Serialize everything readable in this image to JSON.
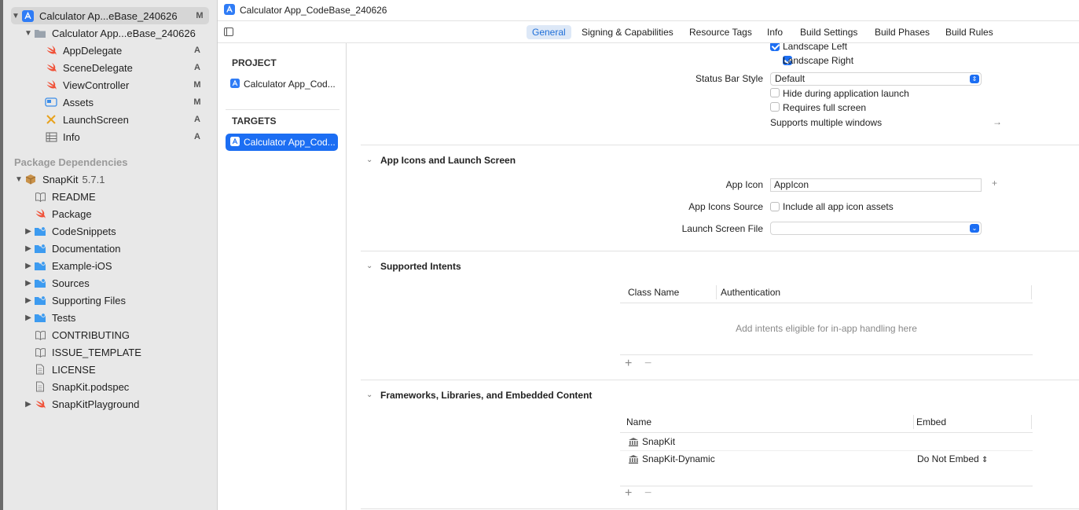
{
  "window": {
    "title": "Calculator App_CodeBase_240626"
  },
  "navigator": {
    "project_root": {
      "label": "Calculator Ap...eBase_240626",
      "badge": "M"
    },
    "group": {
      "label": "Calculator App...eBase_240626"
    },
    "files": [
      {
        "label": "AppDelegate",
        "badge": "A",
        "icon": "swift-icon"
      },
      {
        "label": "SceneDelegate",
        "badge": "A",
        "icon": "swift-icon"
      },
      {
        "label": "ViewController",
        "badge": "M",
        "icon": "swift-icon"
      },
      {
        "label": "Assets",
        "badge": "M",
        "icon": "asset-catalog-icon"
      },
      {
        "label": "LaunchScreen",
        "badge": "A",
        "icon": "storyboard-icon"
      },
      {
        "label": "Info",
        "badge": "A",
        "icon": "plist-icon"
      }
    ],
    "package_deps_title": "Package Dependencies",
    "snapkit": {
      "label": "SnapKit",
      "version": "5.7.1"
    },
    "snapkit_items": [
      {
        "label": "README",
        "icon": "book-icon",
        "folder": false
      },
      {
        "label": "Package",
        "icon": "swift-icon",
        "folder": false
      },
      {
        "label": "CodeSnippets",
        "icon": "folder-icon",
        "folder": true
      },
      {
        "label": "Documentation",
        "icon": "folder-icon",
        "folder": true
      },
      {
        "label": "Example-iOS",
        "icon": "folder-icon",
        "folder": true
      },
      {
        "label": "Sources",
        "icon": "folder-icon",
        "folder": true
      },
      {
        "label": "Supporting Files",
        "icon": "folder-icon",
        "folder": true
      },
      {
        "label": "Tests",
        "icon": "folder-icon",
        "folder": true
      },
      {
        "label": "CONTRIBUTING",
        "icon": "book-icon",
        "folder": false
      },
      {
        "label": "ISSUE_TEMPLATE",
        "icon": "book-icon",
        "folder": false
      },
      {
        "label": "LICENSE",
        "icon": "document-icon",
        "folder": false
      },
      {
        "label": "SnapKit.podspec",
        "icon": "document-icon",
        "folder": false
      },
      {
        "label": "SnapKitPlayground",
        "icon": "swift-icon",
        "folder": true
      }
    ]
  },
  "tabs": [
    "General",
    "Signing & Capabilities",
    "Resource Tags",
    "Info",
    "Build Settings",
    "Build Phases",
    "Build Rules"
  ],
  "target_list": {
    "project_head": "PROJECT",
    "project_item": "Calculator App_Cod...",
    "targets_head": "TARGETS",
    "target_item": "Calculator App_Cod..."
  },
  "deployment": {
    "landscape_left": "Landscape Left",
    "landscape_right": "Landscape Right",
    "status_bar_style_label": "Status Bar Style",
    "status_bar_style_value": "Default",
    "hide_during_launch": "Hide during application launch",
    "requires_full_screen": "Requires full screen",
    "supports_multiple_windows": "Supports multiple windows"
  },
  "app_icons": {
    "title": "App Icons and Launch Screen",
    "app_icon_label": "App Icon",
    "app_icon_value": "AppIcon",
    "app_icons_source_label": "App Icons Source",
    "include_all": "Include all app icon assets",
    "launch_screen_label": "Launch Screen File",
    "launch_screen_value": ""
  },
  "intents": {
    "title": "Supported Intents",
    "col_class": "Class Name",
    "col_auth": "Authentication",
    "placeholder": "Add intents eligible for in-app handling here"
  },
  "frameworks": {
    "title": "Frameworks, Libraries, and Embedded Content",
    "col_name": "Name",
    "col_embed": "Embed",
    "rows": [
      {
        "name": "SnapKit",
        "embed": ""
      },
      {
        "name": "SnapKit-Dynamic",
        "embed": "Do Not Embed"
      }
    ]
  },
  "symbols": {
    "plus": "+",
    "minus": "−",
    "arrow": "→",
    "chev_down": "⌄",
    "up_down": "⌃⌄"
  }
}
